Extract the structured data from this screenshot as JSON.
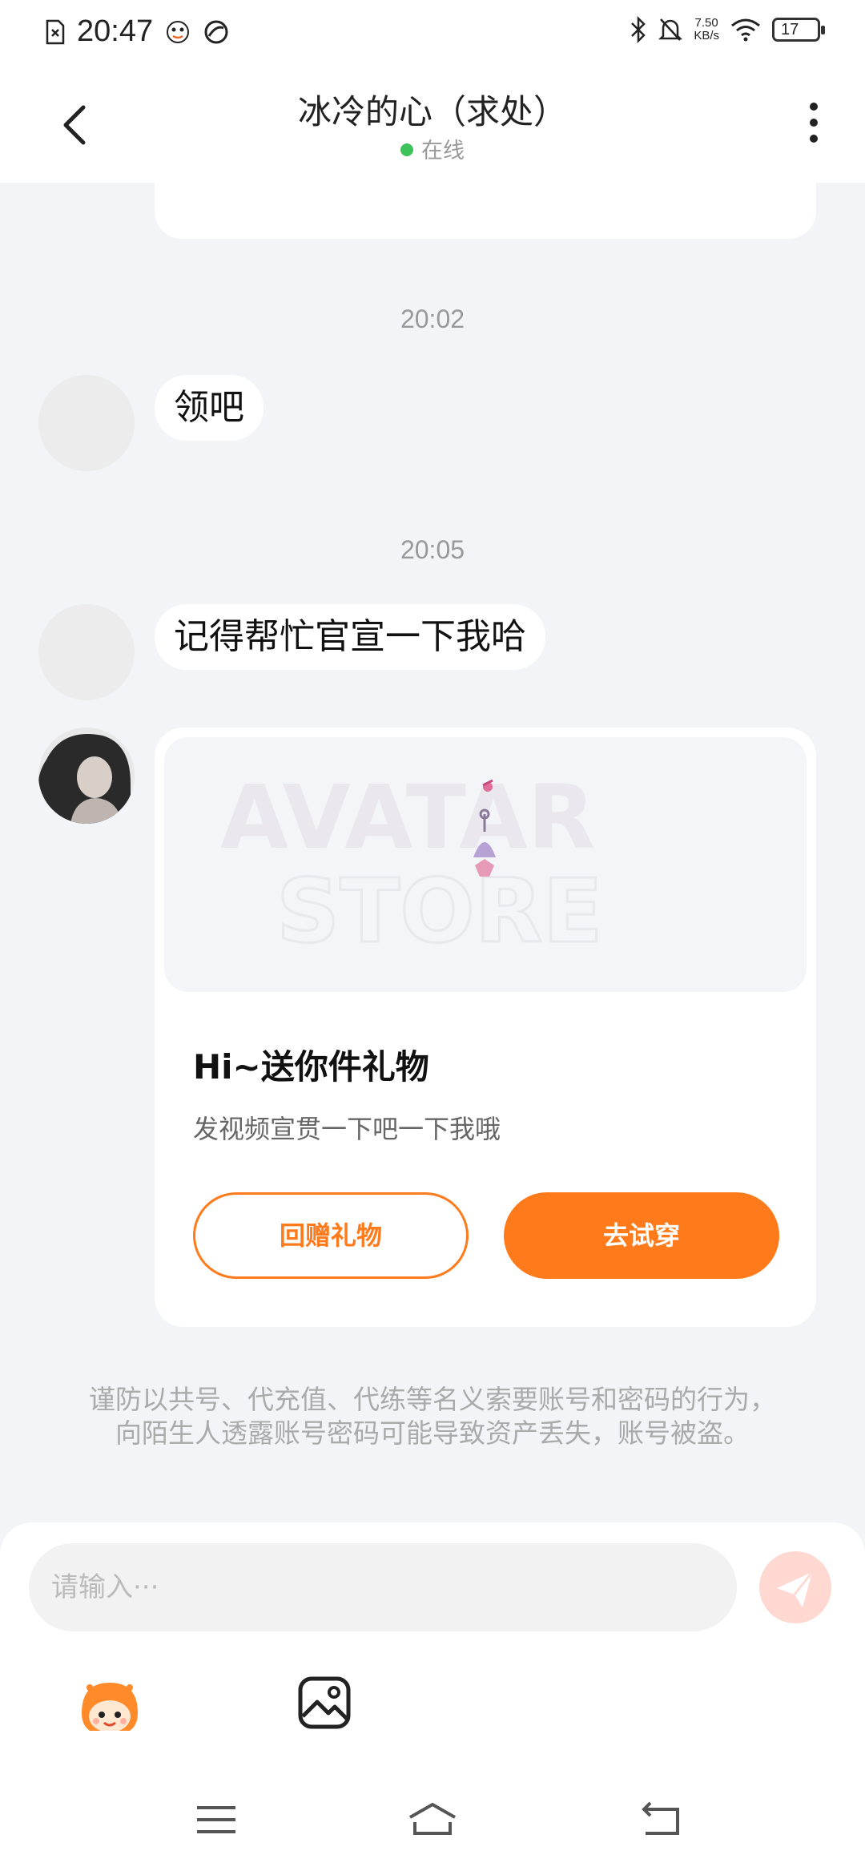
{
  "status_bar": {
    "time": "20:47",
    "speed_value": "7.50",
    "speed_unit": "KB/s",
    "battery": "17"
  },
  "header": {
    "title": "冰冷的心（求处）",
    "status": "在线"
  },
  "messages": {
    "ts1": "20:02",
    "msg1": "领吧",
    "ts2": "20:05",
    "msg2": "记得帮忙官宣一下我哈"
  },
  "gift_card": {
    "title": "Hi~送你件礼物",
    "subtitle": "发视频宣贯一下吧一下我哦",
    "return_gift_label": "回赠礼物",
    "try_on_label": "去试穿",
    "watermark_line1": "AVATAR",
    "watermark_line2": "STORE"
  },
  "notice": "谨防以共号、代充值、代练等名义索要账号和密码的行为，向陌生人透露账号密码可能导致资产丢失，账号被盗。",
  "input": {
    "placeholder": "请输入···"
  },
  "colors": {
    "accent": "#ff7a1a",
    "online": "#3ec35b",
    "send_disabled": "#ffd8d2"
  }
}
